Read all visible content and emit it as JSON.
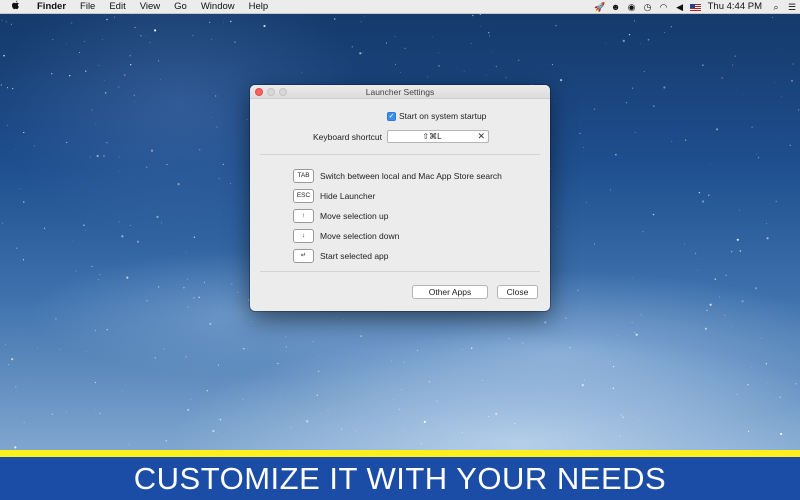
{
  "menubar": {
    "apple_icon": "apple-logo-icon",
    "app_name": "Finder",
    "items": [
      "File",
      "Edit",
      "View",
      "Go",
      "Window",
      "Help"
    ],
    "status_icons": [
      "rocket-icon",
      "smiley-icon",
      "spotify-icon",
      "time-machine-icon",
      "wifi-icon",
      "volume-icon",
      "us-flag-icon"
    ],
    "clock": "Thu 4:44 PM",
    "search_icon": "search-icon",
    "notification_icon": "notification-center-icon"
  },
  "window": {
    "title": "Launcher Settings",
    "startup_label": "Start on system startup",
    "startup_checked": true,
    "shortcut_label": "Keyboard shortcut",
    "shortcut_value": "⇧⌘L",
    "shortcut_clear": "✕",
    "keys": [
      {
        "key": "TAB",
        "description": "Switch between local and Mac App Store search"
      },
      {
        "key": "ESC",
        "description": "Hide Launcher"
      },
      {
        "key": "↑",
        "description": "Move selection up"
      },
      {
        "key": "↓",
        "description": "Move selection down"
      },
      {
        "key": "↵",
        "description": "Start selected app"
      }
    ],
    "buttons": {
      "other_apps": "Other Apps",
      "close": "Close"
    }
  },
  "banner": {
    "text": "CUSTOMIZE IT WITH YOUR NEEDS"
  },
  "colors": {
    "banner_bg": "#1c4da6",
    "banner_stripe": "#ffef1d",
    "checkbox_accent": "#3b8ef0"
  }
}
